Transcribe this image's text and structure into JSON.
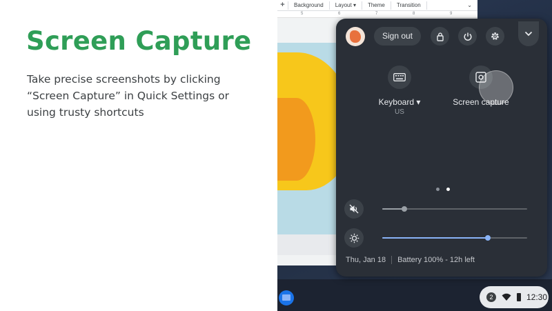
{
  "slide": {
    "title": "Screen Capture",
    "body": "Take precise screenshots by clicking “Screen Capture” in Quick Settings or using trusty shortcuts"
  },
  "editor": {
    "toolbar": {
      "background": "Background",
      "layout": "Layout ▾",
      "theme": "Theme",
      "transition": "Transition",
      "chevron": "⌄"
    },
    "ruler": [
      "5",
      "6",
      "7",
      "8",
      "9"
    ]
  },
  "quick_settings": {
    "sign_out": "Sign out",
    "tiles": [
      {
        "label": "Keyboard ▾",
        "sub": "US",
        "icon": "keyboard-icon"
      },
      {
        "label": "Screen capture",
        "sub": "",
        "icon": "screen-capture-icon"
      }
    ],
    "pages": {
      "count": 2,
      "active": 2
    },
    "volume": {
      "muted": true,
      "level": 0.15
    },
    "brightness": {
      "level": 0.73
    },
    "date": "Thu, Jan 18",
    "battery": "Battery 100% - 12h left",
    "colors": {
      "accent": "#8ab4f8",
      "panel": "#2a2f37"
    }
  },
  "shelf": {
    "notification_count": "2",
    "time": "12:30"
  }
}
